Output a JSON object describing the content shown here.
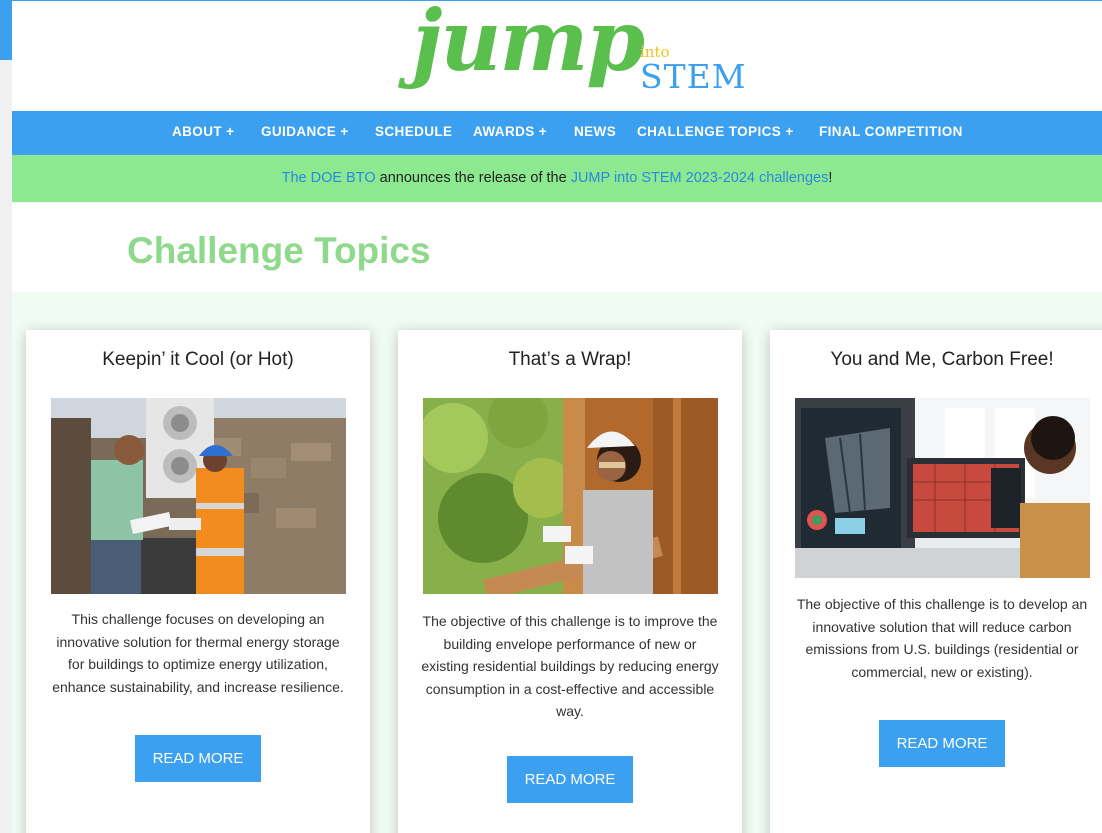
{
  "logo": {
    "jump": "jump",
    "into": "into",
    "stem": "STEM"
  },
  "nav": {
    "items": [
      "ABOUT +",
      "GUIDANCE +",
      "SCHEDULE",
      "AWARDS +",
      "NEWS",
      "CHALLENGE TOPICS +",
      "FINAL COMPETITION"
    ]
  },
  "banner": {
    "link1": "The DOE BTO",
    "middle": " announces the release of the ",
    "link2": "JUMP into STEM 2023-2024 challenges",
    "end": "!"
  },
  "page_title": "Challenge Topics",
  "cards": [
    {
      "title": "Keepin’ it Cool (or Hot)",
      "image": "technicians-inspecting-heat-pump-photo",
      "description": "This challenge focuses on developing an innovative solution for thermal energy storage for buildings to optimize energy utilization, enhance sustainability, and increase resilience.",
      "button": "READ MORE"
    },
    {
      "title": "That’s a Wrap!",
      "image": "smiling-worker-installing-insulation-photo",
      "description": "The objective of this challenge is to improve the building envelope performance of new or existing residential buildings by reducing energy consumption in a cost-effective and accessible way.",
      "button": "READ MORE"
    },
    {
      "title": "You and Me, Carbon Free!",
      "image": "engineer-at-computer-monitors-photo",
      "description": "The objective of this challenge is to develop an innovative solution that will reduce carbon emissions from U.S. buildings (residential or commercial, new or existing).",
      "button": "READ MORE"
    }
  ],
  "colors": {
    "brand_green": "#5bbf4e",
    "brand_blue": "#3aa0ef",
    "brand_yellow": "#f2c21a",
    "banner_green": "#8de98f",
    "title_green": "#8ed98c"
  }
}
